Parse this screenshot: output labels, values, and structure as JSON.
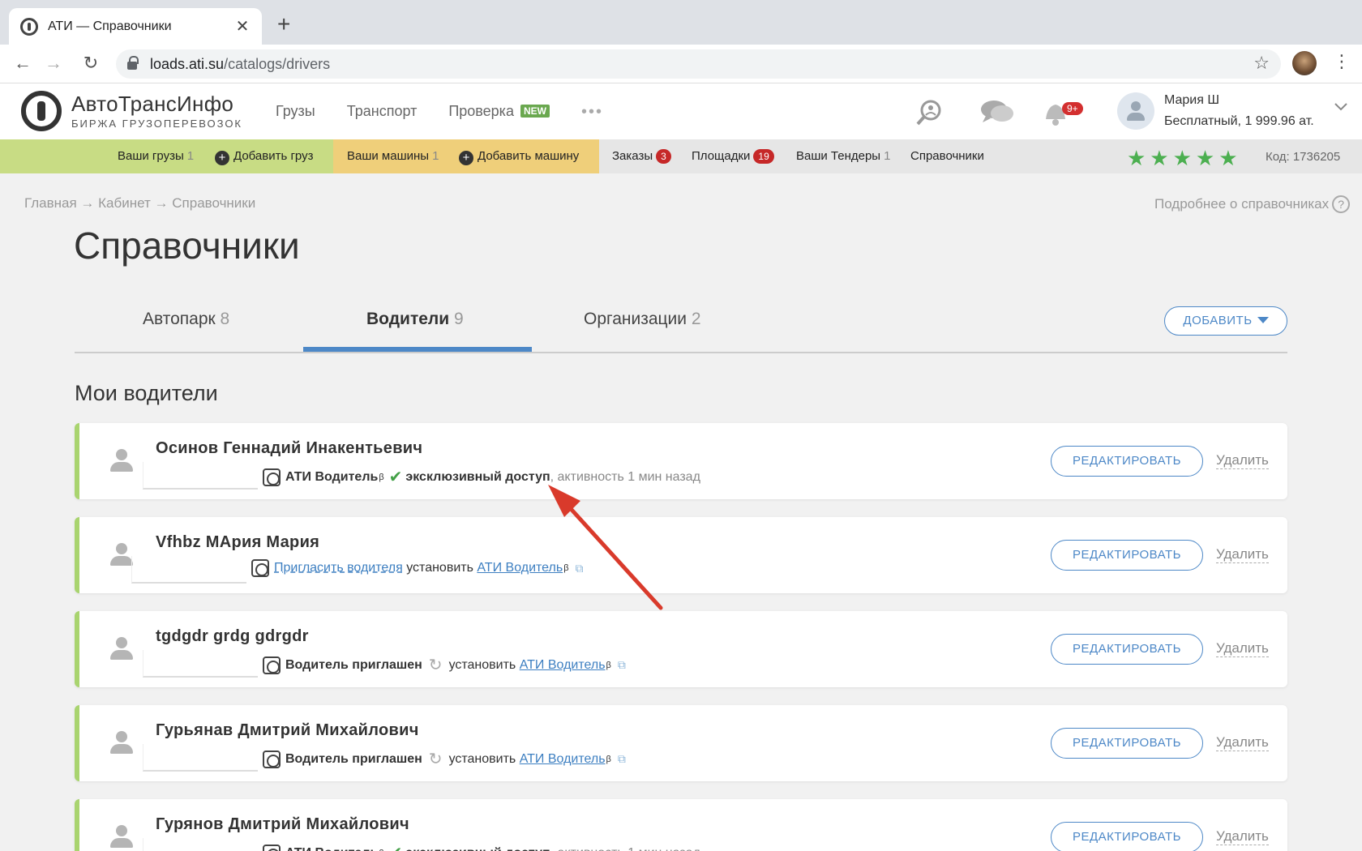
{
  "browser": {
    "tab_title": "АТИ — Справочники",
    "tab_close": "✕",
    "new_tab": "+",
    "url_host": "loads.ati.su",
    "url_path": "/catalogs/drivers",
    "back_icon": "←",
    "forward_icon": "→",
    "reload_icon": "↻",
    "star_icon": "☆",
    "menu_icon": "⋮"
  },
  "site": {
    "logo_title": "АвтоТрансИнфо",
    "logo_subtitle": "БИРЖА ГРУЗОПЕРЕВОЗОК",
    "nav": {
      "cargo": "Грузы",
      "transport": "Транспорт",
      "check": "Проверка",
      "new_badge": "NEW",
      "more": "•••"
    },
    "notifications_badge": "9+",
    "user": {
      "name": "Мария Ш",
      "plan": "Бесплатный,  1 999.96 ат."
    }
  },
  "subnav": {
    "your_cargo": "Ваши грузы",
    "your_cargo_count": "1",
    "add_cargo": "Добавить груз",
    "your_trucks": "Ваши машины",
    "your_trucks_count": "1",
    "add_truck": "Добавить машину",
    "orders": "Заказы",
    "orders_count": "3",
    "platforms": "Площадки",
    "platforms_count": "19",
    "tenders": "Ваши Тендеры",
    "tenders_count": "1",
    "catalogs": "Справочники",
    "stars": "★★★★★",
    "code": "Код: 1736205"
  },
  "page": {
    "breadcrumb": "Главная → Кабинет → Справочники",
    "help_link": "Подробнее о справочниках",
    "title": "Справочники",
    "tabs": [
      {
        "label": "Автопарк",
        "count": "8"
      },
      {
        "label": "Водители",
        "count": "9"
      },
      {
        "label": "Организации",
        "count": "2"
      }
    ],
    "add_button": "ДОБАВИТЬ",
    "section_title": "Мои водители"
  },
  "common": {
    "edit": "РЕДАКТИРОВАТЬ",
    "delete": "Удалить",
    "app_name": "АТИ Водитель",
    "beta": "β",
    "exclusive": "эксклюзивный доступ",
    "activity": ", активность 1 мин назад",
    "invite": "Пригласить водителя",
    "install": "установить",
    "invited": "Водитель приглашен",
    "check_icon": "✔",
    "refresh_icon": "↻",
    "ext_icon": "⧉"
  },
  "drivers": [
    {
      "name": "Осинов Геннадий Инакентьевич",
      "status": "exclusive"
    },
    {
      "name": "Vfhbz МАрия Мария",
      "status": "invite"
    },
    {
      "name": "tgdgdr grdg gdrgdr",
      "status": "invited"
    },
    {
      "name": "Гурьянав Дмитрий Михайлович",
      "status": "invited"
    },
    {
      "name": "Гурянов Дмитрий Михайлович",
      "status": "exclusive"
    }
  ],
  "colors": {
    "accent": "#4d88c7",
    "card_border": "#a9d46f",
    "annotation_arrow": "#d93a2b"
  }
}
